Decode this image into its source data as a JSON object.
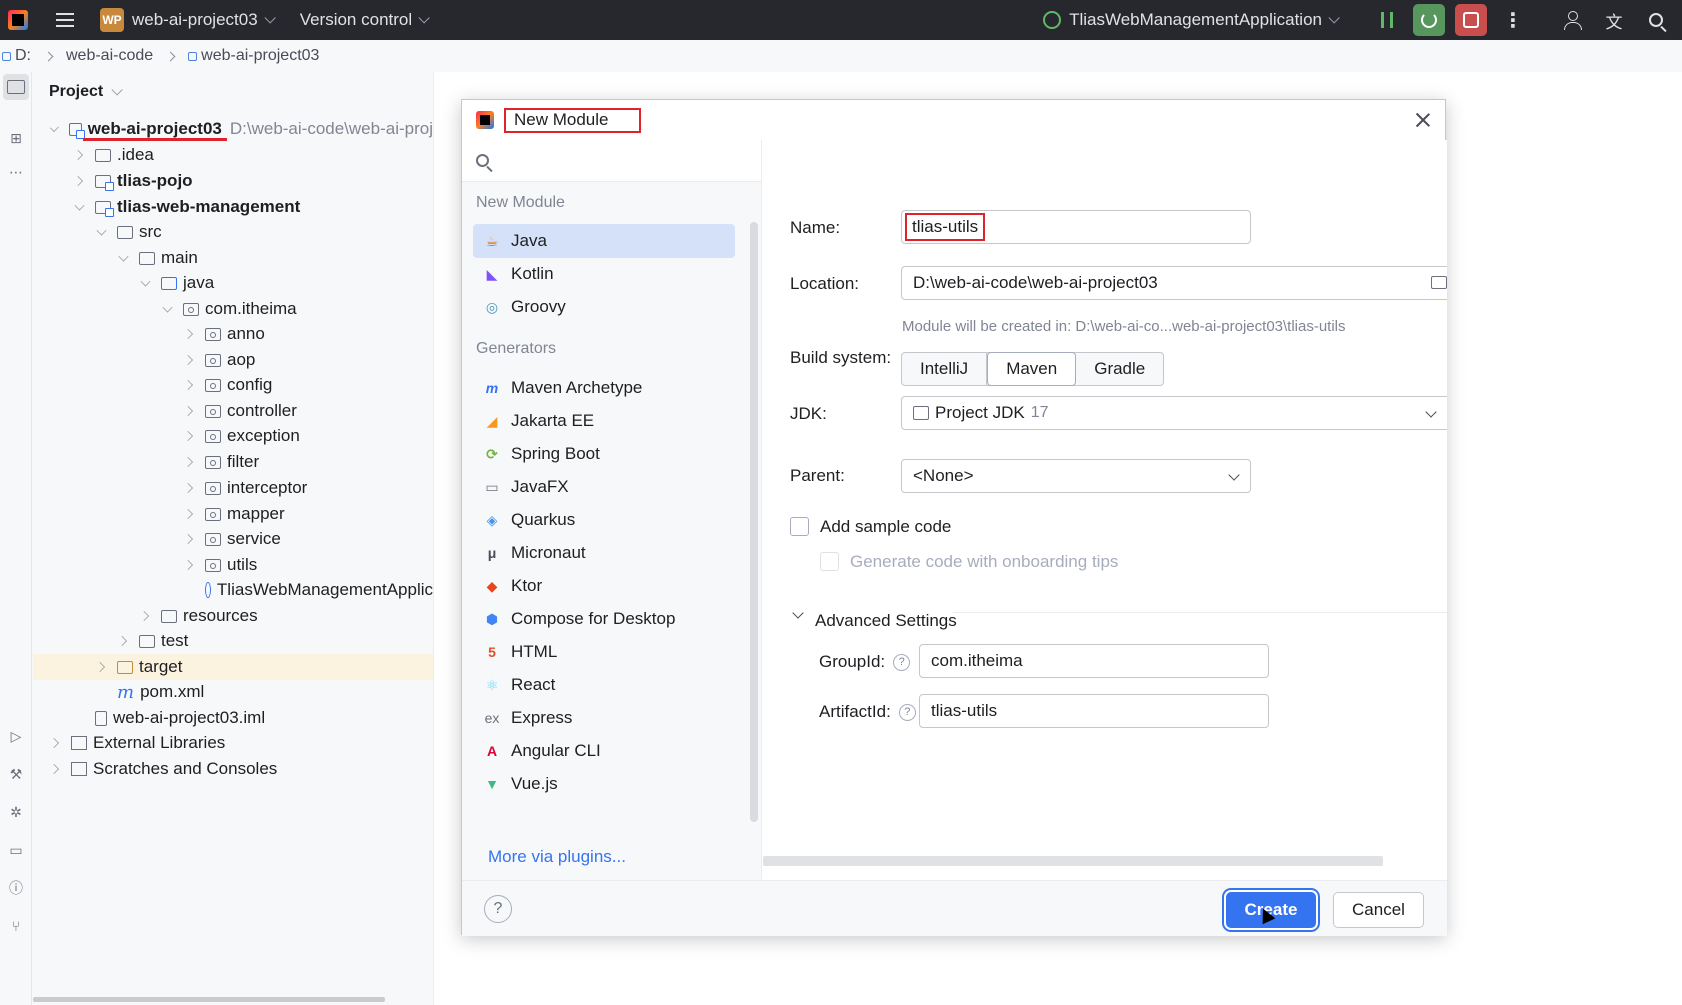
{
  "titlebar": {
    "project_badge": "WP",
    "project_name": "web-ai-project03",
    "version_control": "Version control",
    "run_config": "TliasWebManagementApplication"
  },
  "breadcrumb": {
    "drive": "D:",
    "folder": "web-ai-code",
    "project": "web-ai-project03"
  },
  "project_panel": {
    "title": "Project",
    "root_name": "web-ai-project03",
    "root_path": "D:\\web-ai-code\\web-ai-proj",
    "rows": {
      "idea": ".idea",
      "pojo": "tlias-pojo",
      "web_mgmt": "tlias-web-management",
      "src": "src",
      "main": "main",
      "java": "java",
      "pkg": "com.itheima",
      "anno": "anno",
      "aop": "aop",
      "config": "config",
      "controller": "controller",
      "exception": "exception",
      "filter": "filter",
      "interceptor": "interceptor",
      "mapper": "mapper",
      "service": "service",
      "utils": "utils",
      "app": "TliasWebManagementApplic",
      "resources": "resources",
      "test": "test",
      "target": "target",
      "pom": "pom.xml",
      "iml": "web-ai-project03.iml",
      "ext_libs": "External Libraries",
      "scratches": "Scratches and Consoles"
    }
  },
  "dialog": {
    "title": "New Module",
    "search_placeholder": "",
    "section_new_module": "New Module",
    "section_generators": "Generators",
    "languages": [
      "Java",
      "Kotlin",
      "Groovy"
    ],
    "generators": [
      "Maven Archetype",
      "Jakarta EE",
      "Spring Boot",
      "JavaFX",
      "Quarkus",
      "Micronaut",
      "Ktor",
      "Compose for Desktop",
      "HTML",
      "React",
      "Express",
      "Angular CLI",
      "Vue.js"
    ],
    "more_plugins": "More via plugins...",
    "form": {
      "name_label": "Name:",
      "name_value": "tlias-utils",
      "location_label": "Location:",
      "location_value": "D:\\web-ai-code\\web-ai-project03",
      "location_hint": "Module will be created in: D:\\web-ai-co...web-ai-project03\\tlias-utils",
      "build_label": "Build system:",
      "build_options": [
        "IntelliJ",
        "Maven",
        "Gradle"
      ],
      "build_selected": "Maven",
      "jdk_label": "JDK:",
      "jdk_value": "Project JDK",
      "jdk_version": "17",
      "parent_label": "Parent:",
      "parent_value": "<None>",
      "sample_code": "Add sample code",
      "onboarding_tips": "Generate code with onboarding tips",
      "advanced": "Advanced Settings",
      "groupid_label": "GroupId:",
      "groupid_value": "com.itheima",
      "artifactid_label": "ArtifactId:",
      "artifactid_value": "tlias-utils"
    },
    "buttons": {
      "help": "?",
      "create": "Create",
      "cancel": "Cancel"
    }
  },
  "colors": {
    "accent": "#3574f0",
    "annotation_red": "#e0222b",
    "titlebar_bg": "#27282e",
    "selection": "#d5e1f9"
  }
}
